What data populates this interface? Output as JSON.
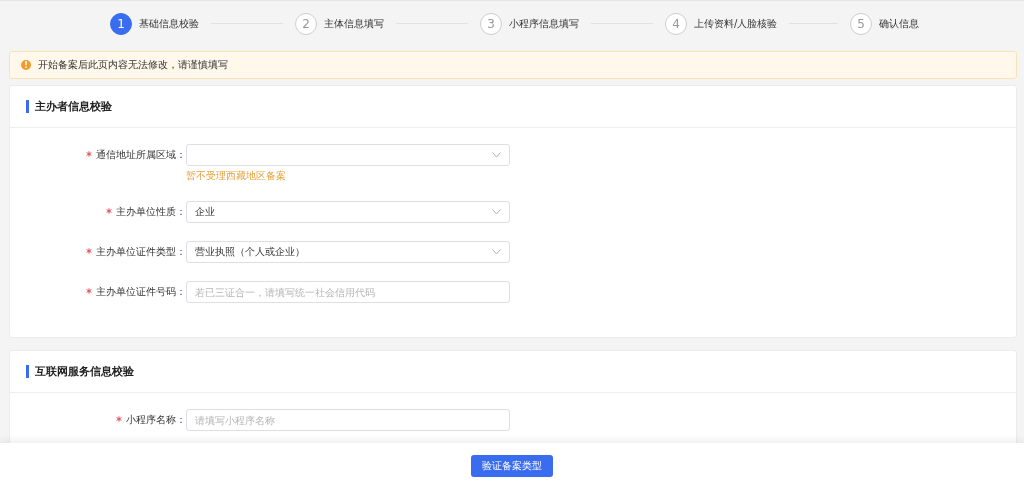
{
  "steps": [
    {
      "number": "1",
      "label": "基础信息校验",
      "selected": true
    },
    {
      "number": "2",
      "label": "主体信息填写",
      "selected": false
    },
    {
      "number": "3",
      "label": "小程序信息填写",
      "selected": false
    },
    {
      "number": "4",
      "label": "上传资料/人脸核验",
      "selected": false
    },
    {
      "number": "5",
      "label": "确认信息",
      "selected": false
    }
  ],
  "notice": {
    "icon": "!",
    "text": "开始备案后此页内容无法修改，请谨慎填写"
  },
  "sections": [
    {
      "title": "主办者信息校验",
      "fields": [
        {
          "kind": "select",
          "required": true,
          "label": "通信地址所属区域：",
          "hint": "暂不受理西藏地区备案"
        },
        {
          "kind": "select",
          "required": true,
          "label": "主办单位性质：",
          "value": "企业"
        },
        {
          "kind": "select",
          "required": true,
          "label": "主办单位证件类型：",
          "value": "营业执照（个人或企业）"
        },
        {
          "kind": "input",
          "required": true,
          "label": "主办单位证件号码：",
          "placeholder": "若已三证合一，请填写统一社会信用代码"
        }
      ]
    },
    {
      "title": "互联网服务信息校验",
      "fields": [
        {
          "kind": "input",
          "required": true,
          "label": "小程序名称：",
          "placeholder": "请填写小程序名称"
        }
      ]
    }
  ],
  "footer": {
    "button": "验证备案类型"
  }
}
